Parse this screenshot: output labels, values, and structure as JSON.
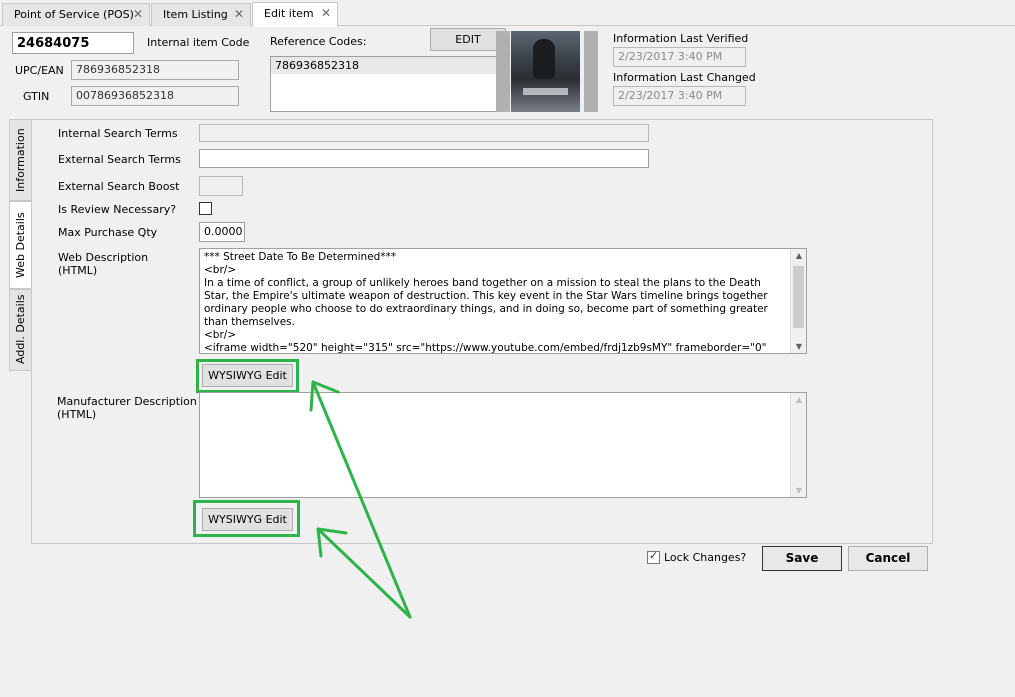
{
  "tabs": [
    {
      "label": "Point of Service (POS)",
      "close": "✕"
    },
    {
      "label": "Item Listing",
      "close": "✕"
    },
    {
      "label": "Edit item",
      "close": "✕"
    }
  ],
  "header": {
    "item_number": "24684075",
    "internal_code_label": "Internal item Code",
    "upc_label": "UPC/EAN",
    "upc_value": "786936852318",
    "gtin_label": "GTIN",
    "gtin_value": "00786936852318",
    "reference_codes_label": "Reference Codes:",
    "edit_button": "EDIT",
    "reference_codes": [
      "786936852318"
    ],
    "last_verified_label": "Information Last Verified",
    "last_verified_value": "2/23/2017 3:40 PM",
    "last_changed_label": "Information Last Changed",
    "last_changed_value": "2/23/2017 3:40 PM"
  },
  "side_tabs": [
    "Information",
    "Web Details",
    "Addl. Details"
  ],
  "form": {
    "internal_search_label": "Internal Search Terms",
    "internal_search_value": "",
    "external_search_label": "External Search Terms",
    "external_search_value": "",
    "boost_label": "External Search Boost",
    "boost_value": "",
    "review_label": "Is Review Necessary?",
    "max_qty_label": "Max Purchase Qty",
    "max_qty_value": "0.0000",
    "web_desc_label_1": "Web Description",
    "web_desc_label_2": "(HTML)",
    "web_desc_text": "*** Street Date To Be Determined***\n<br/>\nIn a time of conflict, a group of unlikely heroes band together on a mission to steal the plans to the Death Star, the Empire's ultimate weapon of destruction. This key event in the Star Wars timeline brings together ordinary people who choose to do extraordinary things, and in doing so, become part of something greater than themselves.\n<br/>\n<iframe width=\"520\" height=\"315\" src=\"https://www.youtube.com/embed/frdj1zb9sMY\" frameborder=\"0\"",
    "wysiwyg_label": "WYSIWYG Edit",
    "mfr_desc_label_1": "Manufacturer Description",
    "mfr_desc_label_2": "(HTML)",
    "mfr_desc_text": ""
  },
  "footer": {
    "lock_label": "Lock Changes?",
    "save_label": "Save",
    "cancel_label": "Cancel"
  },
  "icons": {
    "scroll_up": "▲",
    "scroll_down": "▼",
    "check": "✓"
  },
  "colors": {
    "highlight": "#2db34a"
  }
}
